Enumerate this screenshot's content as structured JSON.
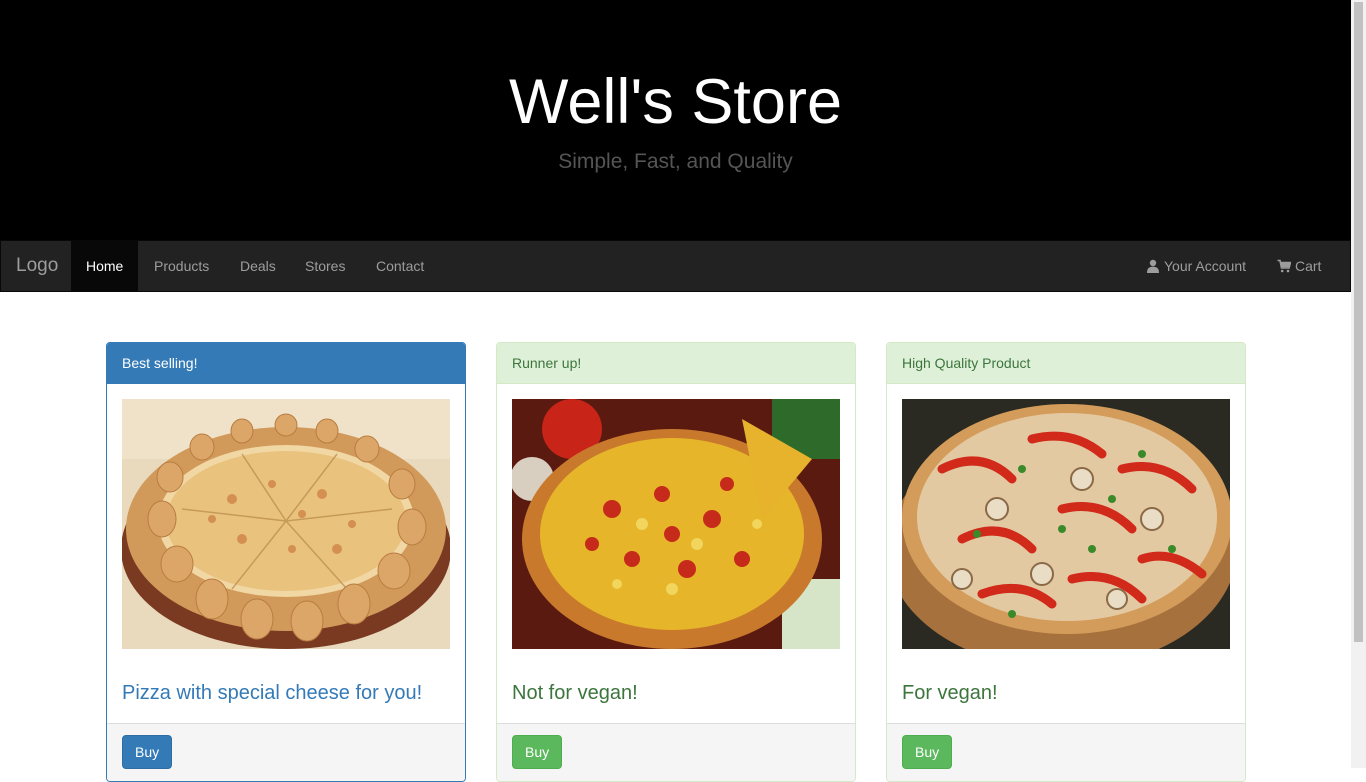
{
  "header": {
    "title": "Well's Store",
    "tagline": "Simple, Fast, and Quality"
  },
  "navbar": {
    "brand": "Logo",
    "items": [
      "Home",
      "Products",
      "Deals",
      "Stores",
      "Contact"
    ],
    "active_item": "Home",
    "right_items": [
      {
        "label": "Your Account",
        "icon": "user-icon"
      },
      {
        "label": "Cart",
        "icon": "cart-icon"
      }
    ]
  },
  "products": [
    {
      "heading": "Best selling!",
      "caption": "Pizza with special cheese for you!",
      "button": "Buy",
      "style": "primary",
      "image": "cheese-crust-pizza"
    },
    {
      "heading": "Runner up!",
      "caption": "Not for vegan!",
      "button": "Buy",
      "style": "success",
      "image": "meat-pizza"
    },
    {
      "heading": "High Quality Product",
      "caption": "For vegan!",
      "button": "Buy",
      "style": "success",
      "image": "veggie-pizza"
    }
  ],
  "colors": {
    "primary": "#337ab7",
    "success": "#5cb85c",
    "navbar_bg": "#222222",
    "jumbotron_bg": "#000000"
  }
}
